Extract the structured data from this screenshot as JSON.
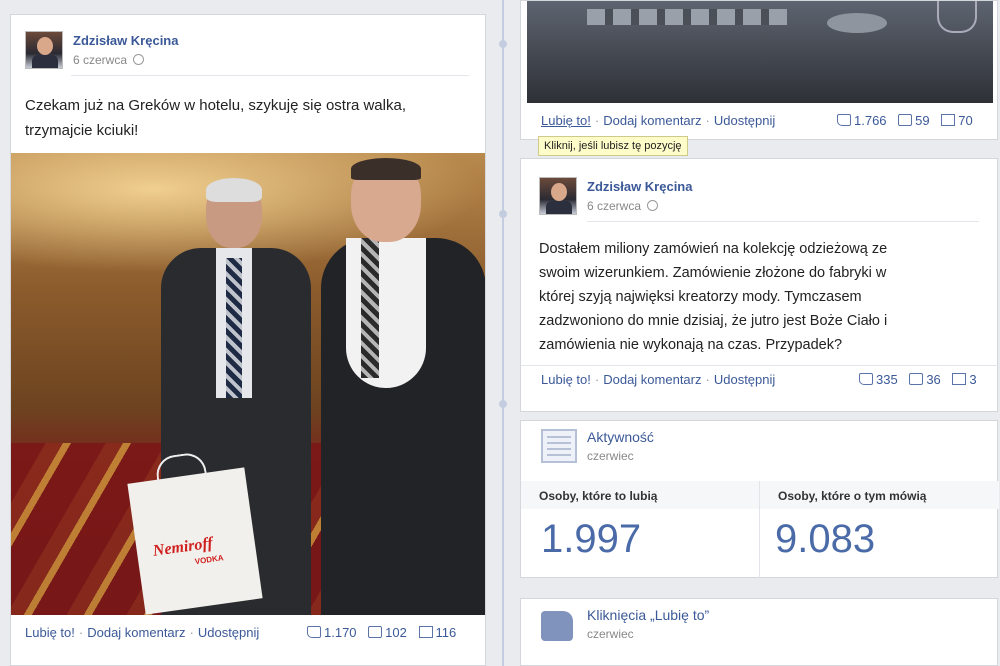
{
  "left_post": {
    "author": "Zdzisław Kręcina",
    "date": "6 czerwca",
    "text_line1": "Czekam już na Greków w hotelu, szykuję się ostra walka,",
    "text_line2": "trzymajcie kciuki!",
    "photo_bag_logo": "Nemiroff",
    "photo_bag_sub": "VODKA",
    "actions": {
      "like": "Lubię to!",
      "comment": "Dodaj komentarz",
      "share": "Udostępnij"
    },
    "counts": {
      "likes": "1.170",
      "comments": "102",
      "shares": "116"
    }
  },
  "right_top_post": {
    "actions": {
      "like": "Lubię to!",
      "comment": "Dodaj komentarz",
      "share": "Udostępnij"
    },
    "counts": {
      "likes": "1.766",
      "comments": "59",
      "shares": "70"
    },
    "tooltip": "Kliknij, jeśli lubisz tę pozycję"
  },
  "right_post": {
    "author": "Zdzisław Kręcina",
    "date": "6 czerwca",
    "text_lines": [
      "Dostałem miliony zamówień na kolekcję odzieżową ze",
      "swoim wizerunkiem. Zamówienie złożone do fabryki w",
      "której szyją najwięksi kreatorzy mody. Tymczasem",
      "zadzwoniono do mnie dzisiaj, że jutro jest Boże Ciało i",
      "zamówienia nie wykonają na czas. Przypadek?"
    ],
    "actions": {
      "like": "Lubię to!",
      "comment": "Dodaj komentarz",
      "share": "Udostępnij"
    },
    "counts": {
      "likes": "335",
      "comments": "36",
      "shares": "3"
    }
  },
  "activity": {
    "title": "Aktywność",
    "subtitle": "czerwiec",
    "col1_header": "Osoby, które to lubią",
    "col1_value": "1.997",
    "col2_header": "Osoby, które o tym mówią",
    "col2_value": "9.083"
  },
  "likes_widget": {
    "title": "Kliknięcia „Lubię to”",
    "subtitle": "czerwiec"
  }
}
